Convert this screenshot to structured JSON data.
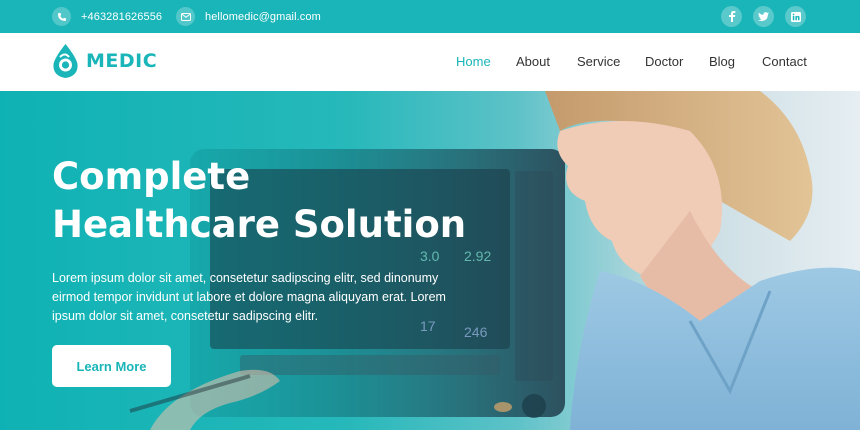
{
  "topbar": {
    "phone": "+463281626556",
    "email": "hellomedic@gmail.com",
    "social_icons": [
      "facebook-icon",
      "twitter-icon",
      "linkedin-icon"
    ]
  },
  "brand": {
    "name": "MEDIC",
    "color": "#19b5b8"
  },
  "nav": {
    "items": [
      "Home",
      "About",
      "Service",
      "Doctor",
      "Blog",
      "Contact"
    ],
    "active": "Home"
  },
  "hero": {
    "title_line1": "Complete",
    "title_line2": "Healthcare Solution",
    "text": "Lorem ipsum dolor sit amet, consetetur sadipscing elitr, sed dinonumy eirmod tempor invidunt ut labore et dolore magna aliquyam erat. Lorem ipsum dolor sit amet, consetetur sadipscing elitr.",
    "button_label": "Learn More",
    "monitor_readings": [
      "3.0",
      "2.92",
      "17",
      "246"
    ]
  },
  "colors": {
    "accent": "#19b5b8",
    "text_dark": "#333333"
  }
}
